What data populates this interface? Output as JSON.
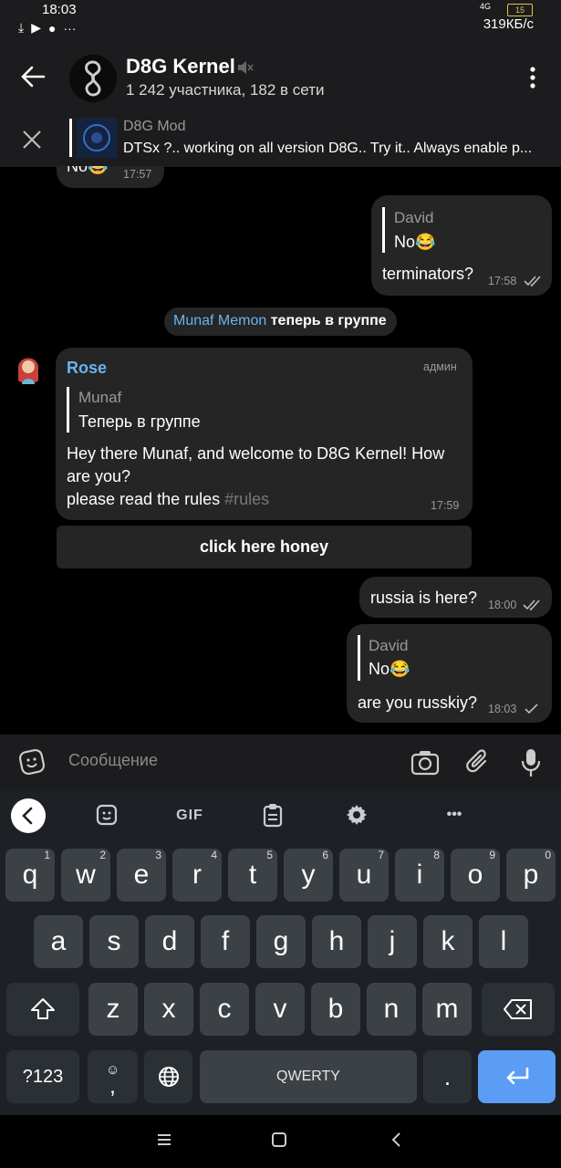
{
  "status": {
    "time": "18:03",
    "net_speed": "319КБ/с",
    "battery": "15",
    "signal": "4G"
  },
  "header": {
    "title": "D8G Kernel",
    "subtitle": "1 242 участника, 182 в сети"
  },
  "pinned": {
    "title": "D8G Mod",
    "text": "DTSx ?.. working on all version D8G.. Try it..  Always enable p..."
  },
  "messages": {
    "m0": {
      "text": "No😂",
      "time": "17:57"
    },
    "m1": {
      "reply_name": "David",
      "reply_text": "No😂",
      "text": "terminators?",
      "time": "17:58"
    },
    "service": {
      "name": "Munaf Memon",
      "text": " теперь в группе"
    },
    "m2": {
      "sender": "Rose",
      "role": "админ",
      "reply_name": "Munaf",
      "reply_text": "Теперь в группе",
      "line1": "Hey there Munaf, and welcome to D8G Kernel! How are you?",
      "line2": "please read the rules ",
      "tag": "#rules",
      "time": "17:59",
      "button": "click here honey"
    },
    "m3": {
      "text": "russia is here?",
      "time": "18:00"
    },
    "m4": {
      "reply_name": "David",
      "reply_text": "No😂",
      "text": "are you russkiy?",
      "time": "18:03"
    }
  },
  "input": {
    "placeholder": "Сообщение"
  },
  "keyboard": {
    "toolbar_gif": "GIF",
    "toolbar_more": "•••",
    "row1": [
      {
        "k": "q",
        "n": "1"
      },
      {
        "k": "w",
        "n": "2"
      },
      {
        "k": "e",
        "n": "3"
      },
      {
        "k": "r",
        "n": "4"
      },
      {
        "k": "t",
        "n": "5"
      },
      {
        "k": "y",
        "n": "6"
      },
      {
        "k": "u",
        "n": "7"
      },
      {
        "k": "i",
        "n": "8"
      },
      {
        "k": "o",
        "n": "9"
      },
      {
        "k": "p",
        "n": "0"
      }
    ],
    "row2": [
      "a",
      "s",
      "d",
      "f",
      "g",
      "h",
      "j",
      "k",
      "l"
    ],
    "row3": [
      "z",
      "x",
      "c",
      "v",
      "b",
      "n",
      "m"
    ],
    "sym": "?123",
    "comma": ",",
    "space": "QWERTY",
    "period": "."
  },
  "colors": {
    "accent": "#64b5f6",
    "name_blue": "#6ab3f3",
    "enter": "#5b9cf4"
  }
}
